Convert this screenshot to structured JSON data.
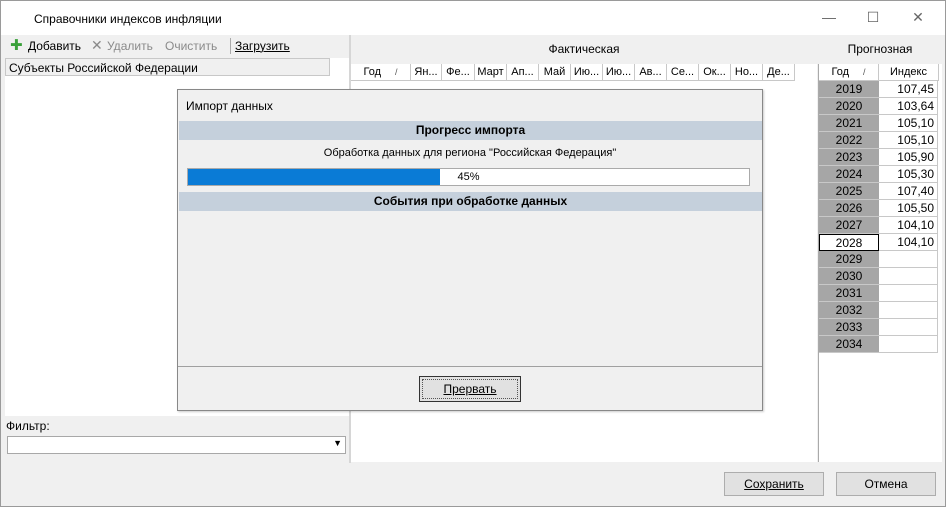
{
  "window": {
    "title": "Справочники индексов инфляции",
    "minimize": "—",
    "maximize": "☐",
    "close": "✕"
  },
  "toolbar": {
    "add_label": "Добавить",
    "delete_label": "Удалить",
    "clear_label": "Очистить",
    "load_label": "Загрузить"
  },
  "left_panel": {
    "header": "Субъекты Российской Федерации",
    "filter_label": "Фильтр:",
    "filter_value": ""
  },
  "fact": {
    "title": "Фактическая",
    "columns": [
      "Год",
      "Ян...",
      "Фе...",
      "Март",
      "Ап...",
      "Май",
      "Ию...",
      "Ию...",
      "Ав...",
      "Се...",
      "Ок...",
      "Но...",
      "Де..."
    ]
  },
  "forecast": {
    "title": "Прогнозная",
    "columns": [
      "Год",
      "Индекс"
    ],
    "rows": [
      {
        "year": "2019",
        "value": "107,45"
      },
      {
        "year": "2020",
        "value": "103,64"
      },
      {
        "year": "2021",
        "value": "105,10"
      },
      {
        "year": "2022",
        "value": "105,10"
      },
      {
        "year": "2023",
        "value": "105,90"
      },
      {
        "year": "2024",
        "value": "105,30"
      },
      {
        "year": "2025",
        "value": "107,40"
      },
      {
        "year": "2026",
        "value": "105,50"
      },
      {
        "year": "2027",
        "value": "104,10"
      },
      {
        "year": "2028",
        "value": "104,10"
      },
      {
        "year": "2029",
        "value": ""
      },
      {
        "year": "2030",
        "value": ""
      },
      {
        "year": "2031",
        "value": ""
      },
      {
        "year": "2032",
        "value": ""
      },
      {
        "year": "2033",
        "value": ""
      },
      {
        "year": "2034",
        "value": ""
      }
    ],
    "selected_year": "2028"
  },
  "dialog": {
    "title": "Импорт данных",
    "progress_header": "Прогресс импорта",
    "status": "Обработка данных для региона \"Российская Федерация\"",
    "progress": 0.45,
    "progress_text": "45%",
    "events_header": "События при обработке данных",
    "abort_label": "Прервать"
  },
  "footer": {
    "save_label": "Сохранить",
    "cancel_label": "Отмена"
  },
  "colors": {
    "progress_fill": "#0a7bd6",
    "section_header": "#c5d0dc",
    "year_cell": "#a6a6a6"
  }
}
